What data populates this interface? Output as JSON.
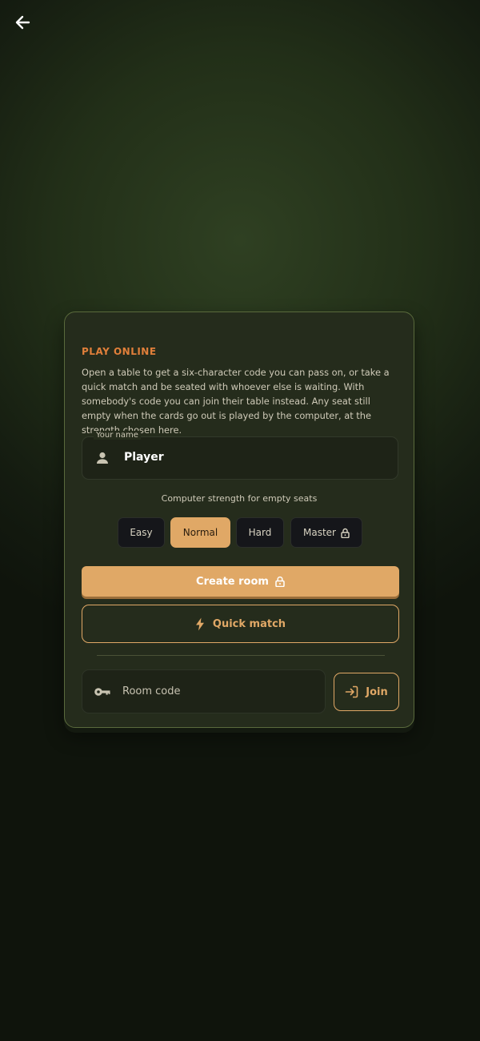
{
  "nav": {
    "back_icon": "arrow-left-icon"
  },
  "colors": {
    "accent": "#e0a866",
    "heading": "#e07f3a",
    "card_bg": "#252c1c"
  },
  "panel": {
    "heading": "PLAY ONLINE",
    "description": "Open a table to get a six-character code you can pass on, or take a quick match and be seated with whoever else is waiting. With somebody's code you can join their table instead. Any seat still empty when the cards go out is played by the computer, at the strength chosen here.",
    "name_field": {
      "label": "Your name",
      "value": "Player",
      "icon": "person-icon"
    },
    "strength": {
      "label": "Computer strength for empty seats",
      "options": [
        {
          "label": "Easy",
          "selected": false,
          "locked": false
        },
        {
          "label": "Normal",
          "selected": true,
          "locked": false
        },
        {
          "label": "Hard",
          "selected": false,
          "locked": false
        },
        {
          "label": "Master",
          "selected": false,
          "locked": true,
          "icon": "lock-icon"
        }
      ]
    },
    "create_room": {
      "label": "Create room",
      "icon": "lock-icon"
    },
    "quick_match": {
      "label": "Quick match",
      "icon": "lightning-icon"
    },
    "room_code": {
      "placeholder": "Room code",
      "value": "",
      "icon": "key-icon"
    },
    "join": {
      "label": "Join",
      "icon": "login-icon"
    }
  }
}
